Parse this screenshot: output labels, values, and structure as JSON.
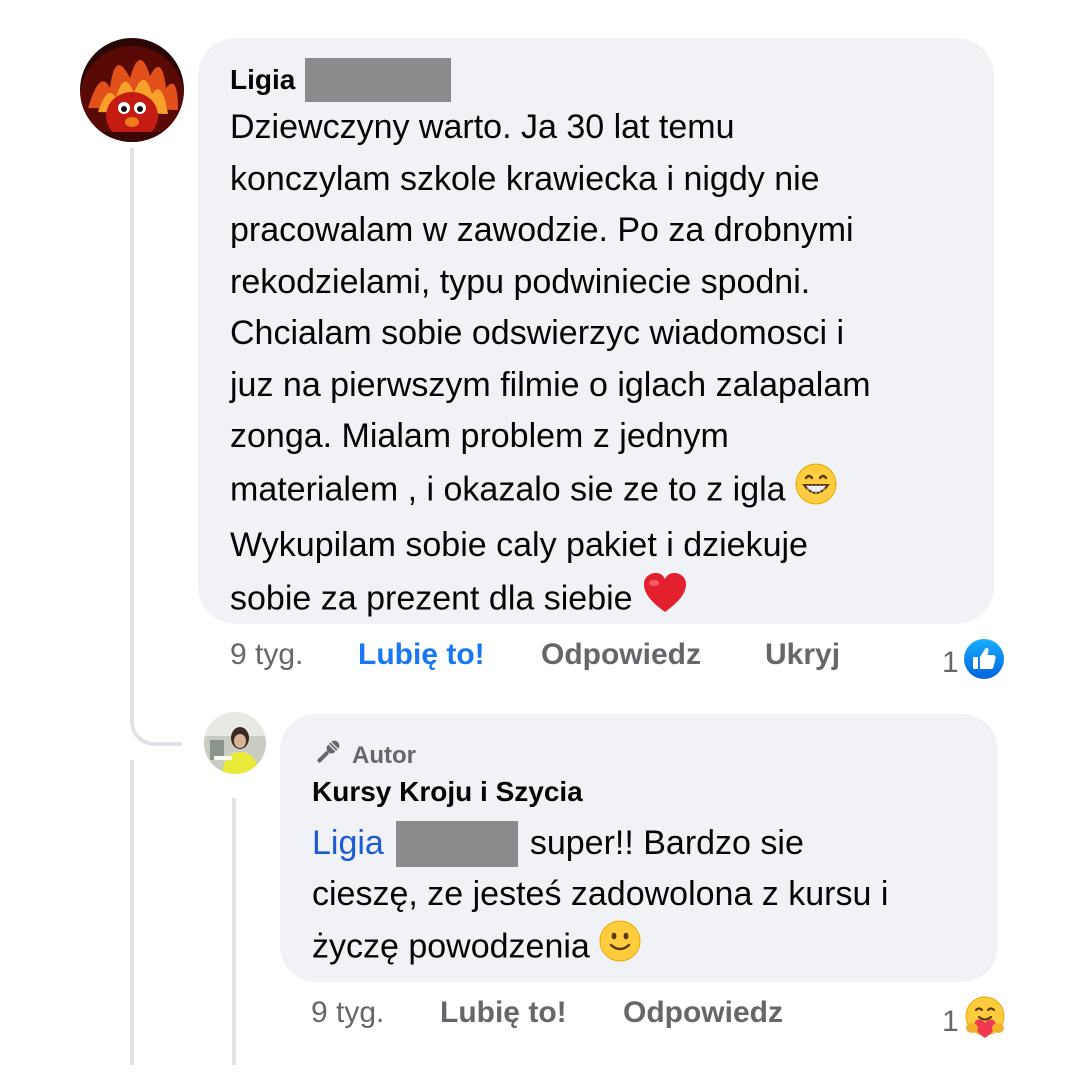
{
  "comment": {
    "author_first": "Ligia",
    "lines": [
      "Dziewczyny warto. Ja 30 lat temu",
      "konczylam szkole krawiecka i nigdy nie",
      "pracowalam w zawodzie. Po za drobnymi",
      "rekodzielami, typu podwiniecie spodni.",
      "Chcialam sobie odswierzyc wiadomosci i",
      "juz na pierwszym filmie o iglach zalapalam",
      "zonga. Mialam problem z jednym",
      "materialem , i okazalo sie ze to z igla",
      "Wykupilam sobie caly pakiet i dziekuje",
      "sobie za prezent dla siebie"
    ],
    "emoji_line8": "grinning-face-emoji",
    "emoji_line10": "red-heart-emoji",
    "time": "9 tyg.",
    "like_label": "Lubię to!",
    "reply_label": "Odpowiedz",
    "hide_label": "Ukryj",
    "reaction_count": "1",
    "reaction_icon": "like-icon",
    "like_color": "#1877f2"
  },
  "reply": {
    "badge_label": "Autor",
    "badge_icon": "microphone-icon",
    "author": "Kursy Kroju i Szycia",
    "mention": "Ligia",
    "line1_rest": "super!! Bardzo sie",
    "line2": "cieszę, ze jesteś zadowolona z kursu i",
    "line3": "życzę powodzenia",
    "emoji_line3": "slightly-smiling-face-emoji",
    "time": "9 tyg.",
    "like_label": "Lubię to!",
    "reply_label": "Odpowiedz",
    "reaction_count": "1",
    "reaction_icon": "care-hug-emoji",
    "mention_color": "#1d5bd3"
  }
}
